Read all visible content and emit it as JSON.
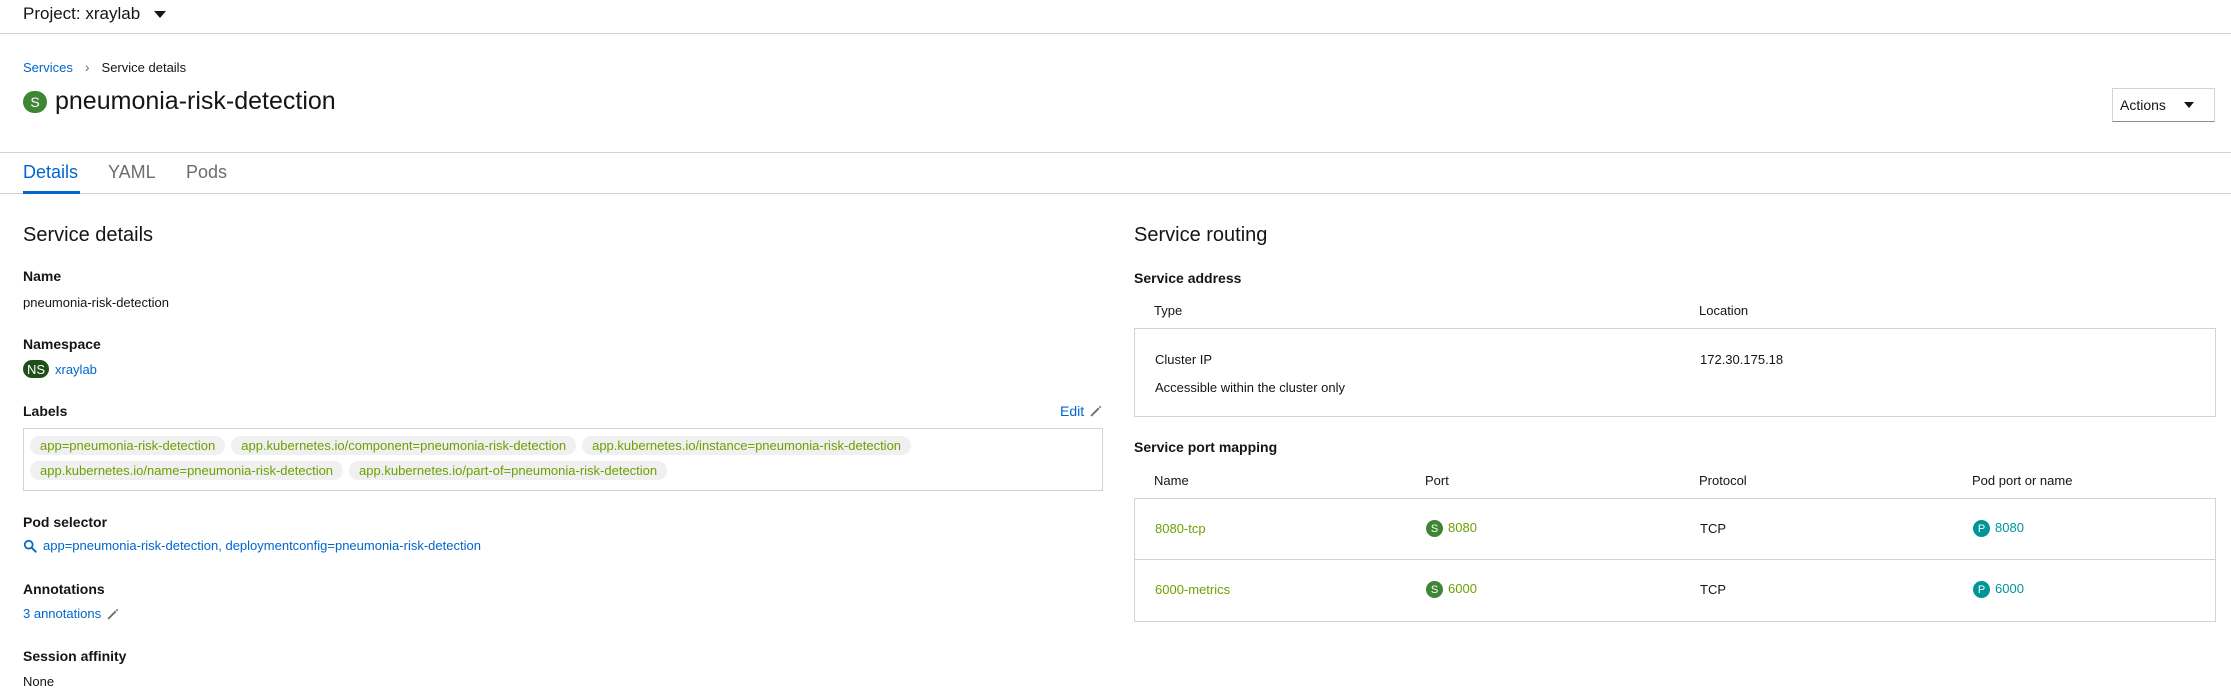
{
  "project": {
    "label": "Project: xraylab"
  },
  "breadcrumb": {
    "parent": "Services",
    "current": "Service details"
  },
  "header": {
    "badge": "S",
    "title": "pneumonia-risk-detection",
    "actions_label": "Actions"
  },
  "tabs": [
    {
      "label": "Details",
      "active": true
    },
    {
      "label": "YAML",
      "active": false
    },
    {
      "label": "Pods",
      "active": false
    }
  ],
  "details": {
    "section_title": "Service details",
    "name_label": "Name",
    "name_value": "pneumonia-risk-detection",
    "namespace_label": "Namespace",
    "namespace_badge": "NS",
    "namespace_value": "xraylab",
    "labels_label": "Labels",
    "edit_label": "Edit",
    "labels_row1": [
      "app=pneumonia-risk-detection",
      "app.kubernetes.io/component=pneumonia-risk-detection",
      "app.kubernetes.io/instance=pneumonia-risk-detection"
    ],
    "labels_row2": [
      "app.kubernetes.io/name=pneumonia-risk-detection",
      "app.kubernetes.io/part-of=pneumonia-risk-detection"
    ],
    "pod_selector_label": "Pod selector",
    "pod_selector_value": "app=pneumonia-risk-detection, deploymentconfig=pneumonia-risk-detection",
    "annotations_label": "Annotations",
    "annotations_value": "3 annotations",
    "session_affinity_label": "Session affinity",
    "session_affinity_value": "None"
  },
  "routing": {
    "section_title": "Service routing",
    "address_label": "Service address",
    "address_headers": {
      "type": "Type",
      "location": "Location"
    },
    "address_type": "Cluster IP",
    "address_note": "Accessible within the cluster only",
    "address_location": "172.30.175.18",
    "port_mapping_label": "Service port mapping",
    "port_headers": {
      "name": "Name",
      "port": "Port",
      "protocol": "Protocol",
      "pod_port": "Pod port or name"
    },
    "ports": [
      {
        "name": "8080-tcp",
        "port_badge": "S",
        "port": "8080",
        "protocol": "TCP",
        "pod_badge": "P",
        "pod_port": "8080"
      },
      {
        "name": "6000-metrics",
        "port_badge": "S",
        "port": "6000",
        "protocol": "TCP",
        "pod_badge": "P",
        "pod_port": "6000"
      }
    ]
  },
  "colors": {
    "link": "#0066cc",
    "service_badge": "#3e8635",
    "namespace_badge": "#1e4f18",
    "label_text": "#6ca100",
    "pod_badge": "#009596"
  }
}
